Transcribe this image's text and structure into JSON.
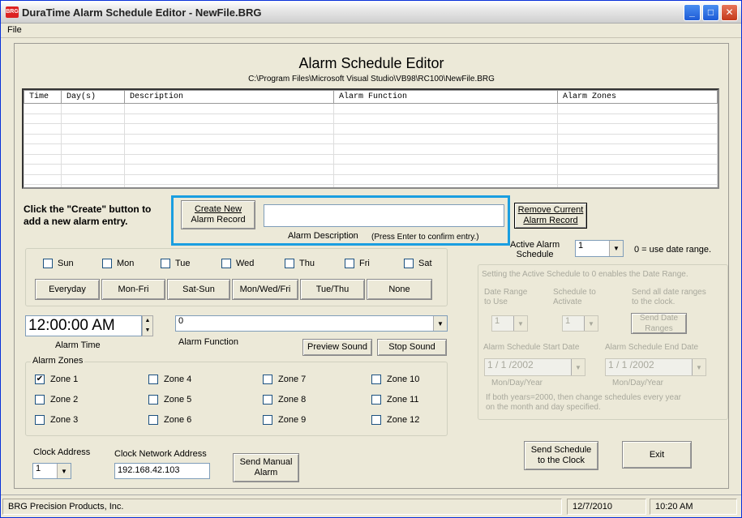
{
  "window": {
    "title": "DuraTime Alarm Schedule Editor - NewFile.BRG",
    "icon_text": "BRG",
    "buttons": {
      "minimize": "_",
      "maximize": "□",
      "close": "✕"
    }
  },
  "menu": {
    "file": "File"
  },
  "header": {
    "title": "Alarm Schedule Editor",
    "path": "C:\\Program Files\\Microsoft Visual Studio\\VB98\\RC100\\NewFile.BRG"
  },
  "grid": {
    "columns": [
      "Time",
      "Day(s)",
      "Description",
      "Alarm Function",
      "Alarm Zones"
    ],
    "rows": 9
  },
  "create": {
    "instruction_line1": "Click the \"Create\" button to",
    "instruction_line2": "add a new alarm entry.",
    "create_button_line1": "Create New",
    "create_button_line2": "Alarm Record",
    "description_value": "",
    "description_label": "Alarm Description",
    "confirm_hint": "(Press Enter to confirm entry.)",
    "remove_button_line1": "Remove Current",
    "remove_button_line2": "Alarm Record",
    "highlight_color": "#1a9ee0"
  },
  "days": {
    "items": [
      "Sun",
      "Mon",
      "Tue",
      "Wed",
      "Thu",
      "Fri",
      "Sat"
    ],
    "presets": [
      "Everyday",
      "Mon-Fri",
      "Sat-Sun",
      "Mon/Wed/Fri",
      "Tue/Thu",
      "None"
    ]
  },
  "time": {
    "value": "12:00:00 AM",
    "label": "Alarm Time"
  },
  "function": {
    "value": "0",
    "label": "Alarm Function",
    "preview": "Preview Sound",
    "stop": "Stop Sound"
  },
  "zones": {
    "title": "Alarm Zones",
    "items": [
      "Zone 1",
      "Zone 4",
      "Zone 7",
      "Zone 10",
      "Zone 2",
      "Zone 5",
      "Zone 8",
      "Zone 11",
      "Zone 3",
      "Zone 6",
      "Zone 9",
      "Zone 12"
    ],
    "checked": "✔"
  },
  "clock": {
    "address_label": "Clock Address",
    "address_value": "1",
    "network_label": "Clock Network Address",
    "network_value": "192.168.42.103",
    "send_manual_line1": "Send Manual",
    "send_manual_line2": "Alarm"
  },
  "schedule": {
    "active_label_line1": "Active Alarm",
    "active_label_line2": "Schedule",
    "active_value": "1",
    "active_hint": "0 = use date range.",
    "group_title": "Setting the Active Schedule to 0 enables the Date Range.",
    "range_label_line1": "Date Range",
    "range_label_line2": "to Use",
    "range_value": "1",
    "activate_label_line1": "Schedule to",
    "activate_label_line2": "Activate",
    "activate_value": "1",
    "send_all_line1": "Send all date ranges",
    "send_all_line2": "to the clock.",
    "send_dates_line1": "Send Date",
    "send_dates_line2": "Ranges",
    "start_label": "Alarm Schedule Start Date",
    "end_label": "Alarm Schedule End Date",
    "start_value": "1 / 1 /2002",
    "end_value": "1 / 1 /2002",
    "date_format": "Mon/Day/Year",
    "footnote_line1": "If both years=2000, then change schedules every year",
    "footnote_line2": "on the month and day specified.",
    "send_schedule_line1": "Send Schedule",
    "send_schedule_line2": "to the Clock",
    "exit": "Exit"
  },
  "status": {
    "company": "BRG Precision Products, Inc.",
    "date": "12/7/2010",
    "time": "10:20 AM"
  },
  "icons": {
    "dropdown": "▼",
    "spin_up": "▲",
    "spin_down": "▼"
  }
}
